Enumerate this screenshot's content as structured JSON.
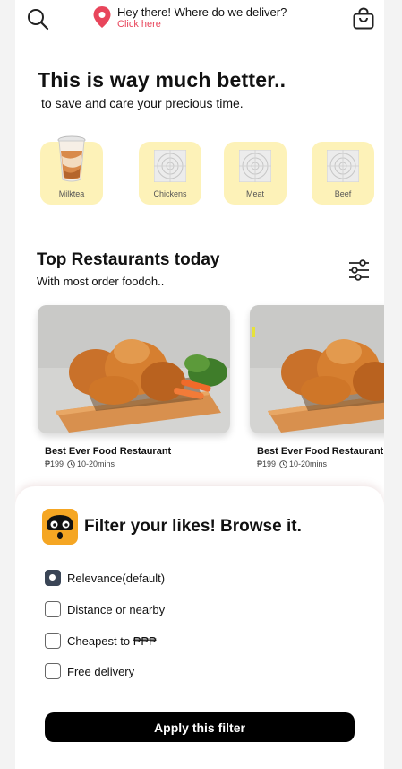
{
  "header": {
    "location_title": "Hey there! Where do we deliver?",
    "location_link": "Click here",
    "accent_color": "#e8455b"
  },
  "hero": {
    "title": "This is way much better..",
    "subtitle": "to save and care your precious  time."
  },
  "categories": [
    {
      "label": "Milktea",
      "icon": "milktea-image"
    },
    {
      "label": "Chickens",
      "icon": "placeholder-image"
    },
    {
      "label": "Meat",
      "icon": "placeholder-image"
    },
    {
      "label": "Beef",
      "icon": "placeholder-image"
    }
  ],
  "restaurants_section": {
    "title": "Top Restaurants today",
    "subtitle": "With most order foodoh.."
  },
  "restaurants": [
    {
      "name": "Best Ever Food Restaurant",
      "price": "₱199",
      "time": "10-20mins"
    },
    {
      "name": "Best Ever Food Restaurant",
      "price": "₱199",
      "time": "10-20mins"
    }
  ],
  "filter_sheet": {
    "title": "Filter your likes! Browse it.",
    "options": [
      {
        "label": "Relevance(default)",
        "checked": true
      },
      {
        "label": "Distance or nearby",
        "checked": false
      },
      {
        "label": "Cheapest to ₱₱₱",
        "checked": false
      },
      {
        "label": "Free delivery",
        "checked": false
      }
    ],
    "apply_label": "Apply this filter"
  },
  "colors": {
    "category_bg": "#fdf2b8",
    "logo_orange": "#f5a623",
    "button_bg": "#000000"
  }
}
